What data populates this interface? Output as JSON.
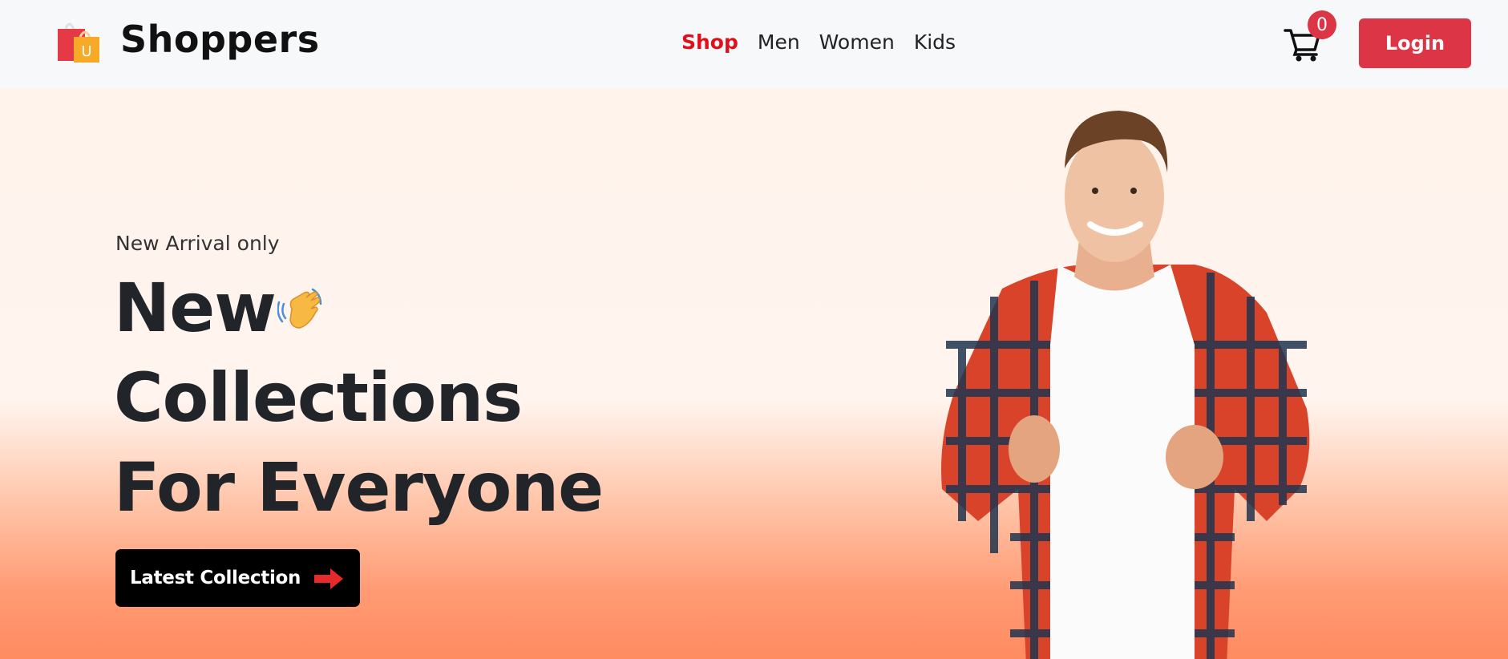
{
  "brand": {
    "name": "Shoppers",
    "logo_icon": "shopping-bag-icon",
    "logo_letter": "U"
  },
  "nav": {
    "items": [
      {
        "label": "Shop",
        "active": true
      },
      {
        "label": "Men",
        "active": false
      },
      {
        "label": "Women",
        "active": false
      },
      {
        "label": "Kids",
        "active": false
      }
    ]
  },
  "cart": {
    "icon": "cart-icon",
    "count": "0"
  },
  "login": {
    "label": "Login"
  },
  "hero": {
    "eyebrow": "New Arrival only",
    "headline": [
      "New",
      "Collections",
      "For Everyone"
    ],
    "wave_icon": "waving-hand-icon",
    "cta_label": "Latest Collection",
    "cta_icon": "arrow-right-icon",
    "image_icon": "model-photo"
  },
  "colors": {
    "accent": "#dc3545",
    "active_nav": "#e0101a",
    "navbar_bg": "#f7f8fa",
    "hero_gradient_top": "#fff3ec",
    "hero_gradient_bottom": "#ff8b61"
  }
}
